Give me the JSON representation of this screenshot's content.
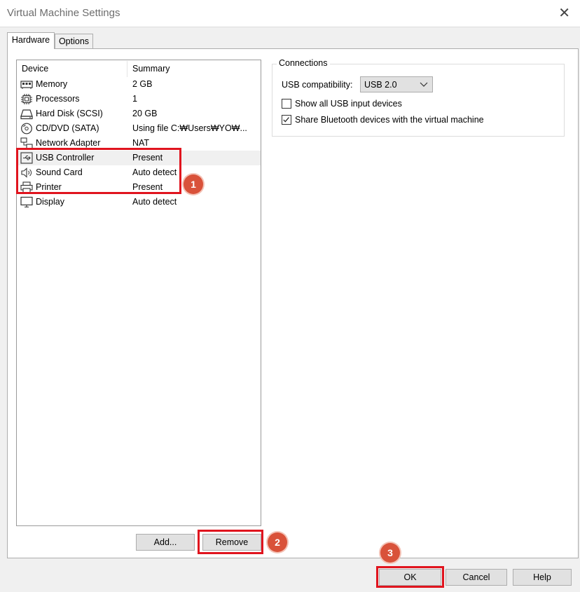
{
  "window": {
    "title": "Virtual Machine Settings"
  },
  "tabs": [
    {
      "label": "Hardware",
      "active": true
    },
    {
      "label": "Options",
      "active": false
    }
  ],
  "device_list": {
    "columns": [
      "Device",
      "Summary"
    ],
    "rows": [
      {
        "device": "Memory",
        "summary": "2 GB",
        "icon": "memory-icon"
      },
      {
        "device": "Processors",
        "summary": "1",
        "icon": "processor-icon"
      },
      {
        "device": "Hard Disk (SCSI)",
        "summary": "20 GB",
        "icon": "hard-disk-icon"
      },
      {
        "device": "CD/DVD (SATA)",
        "summary": "Using file C:₩Users₩YO₩...",
        "icon": "cd-dvd-icon"
      },
      {
        "device": "Network Adapter",
        "summary": "NAT",
        "icon": "network-adapter-icon"
      },
      {
        "device": "USB Controller",
        "summary": "Present",
        "icon": "usb-icon",
        "selected": true
      },
      {
        "device": "Sound Card",
        "summary": "Auto detect",
        "icon": "speaker-icon"
      },
      {
        "device": "Printer",
        "summary": "Present",
        "icon": "printer-icon"
      },
      {
        "device": "Display",
        "summary": "Auto detect",
        "icon": "monitor-icon"
      }
    ]
  },
  "list_buttons": {
    "add": "Add...",
    "remove": "Remove"
  },
  "connections": {
    "title": "Connections",
    "usb_compat_label": "USB compatibility:",
    "usb_compat_value": "USB 2.0",
    "show_all_usb": {
      "label": "Show all USB input devices",
      "checked": false
    },
    "share_bluetooth": {
      "label": "Share Bluetooth devices with the virtual machine",
      "checked": true
    }
  },
  "footer": {
    "ok": "OK",
    "cancel": "Cancel",
    "help": "Help"
  },
  "annotations": {
    "step1": "1",
    "step2": "2",
    "step3": "3"
  },
  "colors": {
    "highlight": "#e0141e",
    "badge": "#d9523a"
  }
}
